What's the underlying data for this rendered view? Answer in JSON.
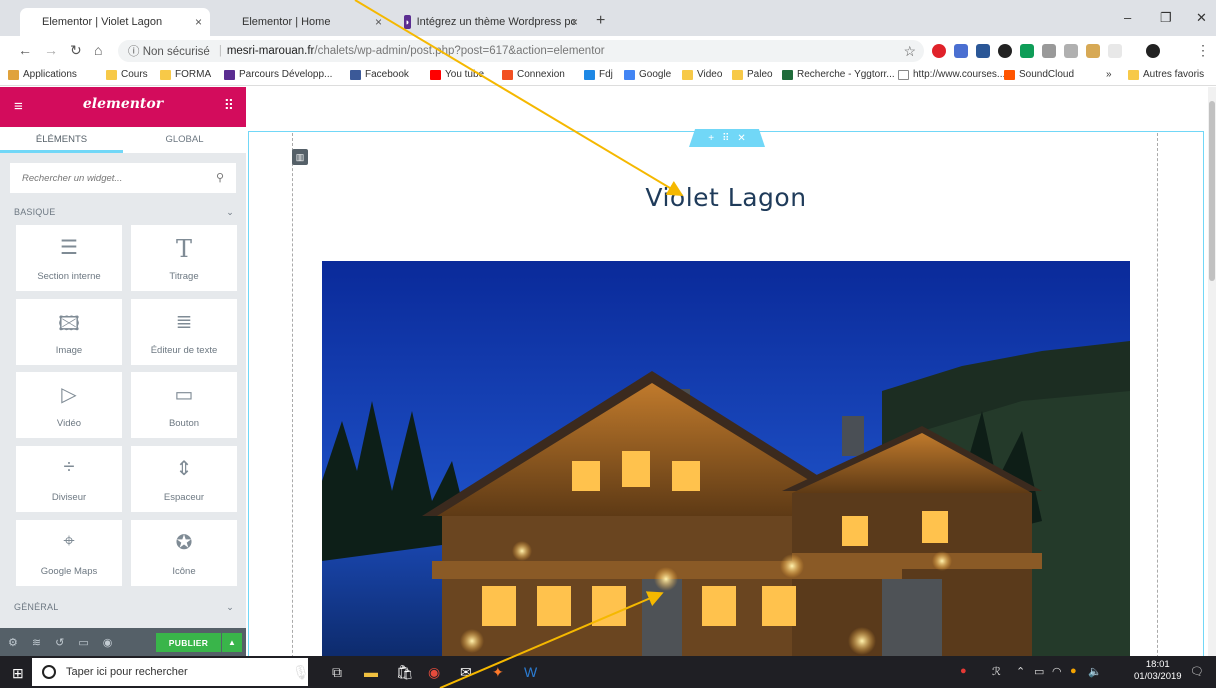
{
  "browser": {
    "tabs": [
      {
        "label": "Elementor | Violet Lagon",
        "active": true
      },
      {
        "label": "Elementor | Home",
        "active": false
      },
      {
        "label": "Intégrez un thème Wordpress pc",
        "active": false
      }
    ],
    "tab_close": "×",
    "new_tab": "+",
    "security_label": "ⓘ Non sécurisé",
    "url_host": "mesri-marouan.fr",
    "url_path": "/chalets/wp-admin/post.php?post=617&action=elementor",
    "bookmarks": [
      "Applications",
      "Cours",
      "FORMA",
      "Parcours Développ...",
      "Facebook",
      "You tube",
      "Connexion",
      "Fdj",
      "Google",
      "Video",
      "Paleo",
      "Recherche - Yggtorr...",
      "http://www.courses...",
      "SoundCloud"
    ],
    "more_bookmarks": "»",
    "other_favorites": "Autres favoris"
  },
  "panel": {
    "logo": "elementor",
    "tab_elements": "ÉLÉMENTS",
    "tab_global": "GLOBAL",
    "search_placeholder": "Rechercher un widget...",
    "category_basic": "BASIQUE",
    "category_general": "GÉNÉRAL",
    "widgets": [
      {
        "label": "Section interne",
        "icon": "inner-section-icon"
      },
      {
        "label": "Titrage",
        "icon": "heading-icon"
      },
      {
        "label": "Image",
        "icon": "image-icon"
      },
      {
        "label": "Éditeur de texte",
        "icon": "text-editor-icon"
      },
      {
        "label": "Vidéo",
        "icon": "video-icon"
      },
      {
        "label": "Bouton",
        "icon": "button-icon"
      },
      {
        "label": "Diviseur",
        "icon": "divider-icon"
      },
      {
        "label": "Espaceur",
        "icon": "spacer-icon"
      },
      {
        "label": "Google Maps",
        "icon": "map-icon"
      },
      {
        "label": "Icône",
        "icon": "star-icon"
      }
    ],
    "publish_label": "PUBLIER"
  },
  "page": {
    "title": "Violet Lagon",
    "image_alt": "Chalet illuminé la nuit"
  },
  "taskbar": {
    "search_placeholder": "Taper ici pour rechercher",
    "time": "18:01",
    "date": "01/03/2019"
  },
  "colors": {
    "elementor_pink": "#d30c5c",
    "publish_green": "#39b54a",
    "section_blue": "#71d7f7",
    "title_navy": "#1f3b5a",
    "arrow": "#f5b800"
  }
}
